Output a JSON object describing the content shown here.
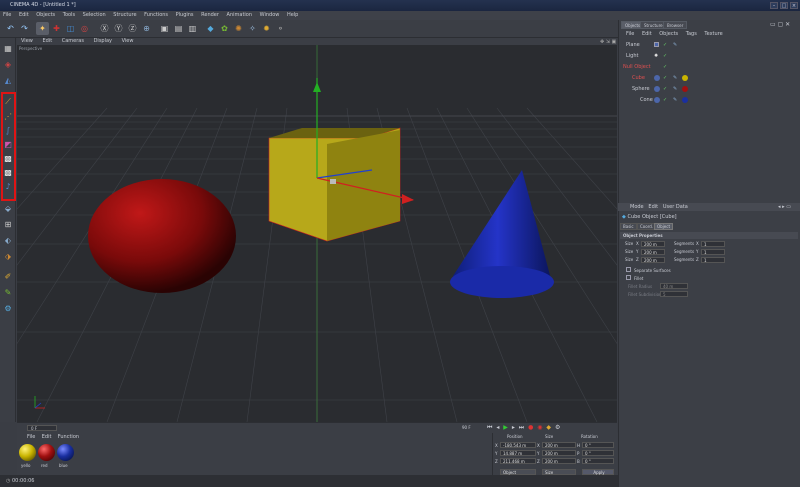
{
  "app": {
    "title": "CINEMA 4D - [Untitled 1 *]"
  },
  "menubar": [
    "File",
    "Edit",
    "Objects",
    "Tools",
    "Selection",
    "Structure",
    "Functions",
    "Plugins",
    "Render",
    "Animation",
    "Window",
    "Help"
  ],
  "viewport": {
    "menu": [
      "View",
      "Edit",
      "Cameras",
      "Display",
      "View"
    ],
    "label": "Perspective",
    "objects": [
      "sphere",
      "cube",
      "cone"
    ]
  },
  "object_manager": {
    "tabs": [
      "Objects",
      "Structure",
      "Browser"
    ],
    "menu": [
      "File",
      "Edit",
      "Objects",
      "Tags",
      "Texture"
    ],
    "rows": [
      {
        "name": "Plane",
        "color": "#c9ccd4"
      },
      {
        "name": "Light",
        "color": "#c9ccd4"
      },
      {
        "name": "Null Object",
        "color": "#e05050"
      },
      {
        "name": "Cube",
        "color": "#e05050"
      },
      {
        "name": "Sphere",
        "color": "#c9ccd4"
      },
      {
        "name": "Cone",
        "color": "#c9ccd4"
      }
    ]
  },
  "attribute_manager": {
    "menu": [
      "Mode",
      "Edit",
      "User Data"
    ],
    "title": "Cube Object [Cube]",
    "tabs": [
      "Basic",
      "Coord.",
      "Object"
    ],
    "section": "Object Properties",
    "size_label": "Size",
    "segments_label": "Segments",
    "axes": [
      "X",
      "Y",
      "Z"
    ],
    "sizes": [
      "200 m",
      "200 m",
      "200 m"
    ],
    "segments": [
      "1",
      "1",
      "1"
    ],
    "separate_surfaces": "Separate Surfaces",
    "fillet": "Fillet",
    "fillet_radius_label": "Fillet Radius",
    "fillet_radius": "40 m",
    "fillet_subdivision_label": "Fillet Subdivision",
    "fillet_subdivision": "5"
  },
  "materials": {
    "menu": [
      "File",
      "Edit",
      "Function"
    ],
    "items": [
      {
        "name": "yello",
        "color": "#c9b400"
      },
      {
        "name": "red",
        "color": "#a01010"
      },
      {
        "name": "blue",
        "color": "#1a2fa0"
      }
    ]
  },
  "timeline": {
    "frame_start": "0 F",
    "frame_end": "90 F"
  },
  "coordinates": {
    "headers": [
      "Position",
      "Size",
      "Rotation"
    ],
    "position": [
      {
        "axis": "X",
        "value": "-180.543 m"
      },
      {
        "axis": "Y",
        "value": "14.887 m"
      },
      {
        "axis": "Z",
        "value": "211.468 m"
      }
    ],
    "size": [
      {
        "axis": "X",
        "value": "200 m"
      },
      {
        "axis": "Y",
        "value": "200 m"
      },
      {
        "axis": "Z",
        "value": "200 m"
      }
    ],
    "rotation": [
      {
        "axis": "H",
        "value": "0 °"
      },
      {
        "axis": "P",
        "value": "0 °"
      },
      {
        "axis": "B",
        "value": "0 °"
      }
    ],
    "mode_object": "Object",
    "mode_size": "Size",
    "apply": "Apply"
  },
  "status": {
    "time": "00:00:06"
  },
  "colors": {
    "selection_outline": "#e01414",
    "cube": "#c4b51e",
    "sphere": "#8a0d0d",
    "cone": "#1a2aa8"
  }
}
